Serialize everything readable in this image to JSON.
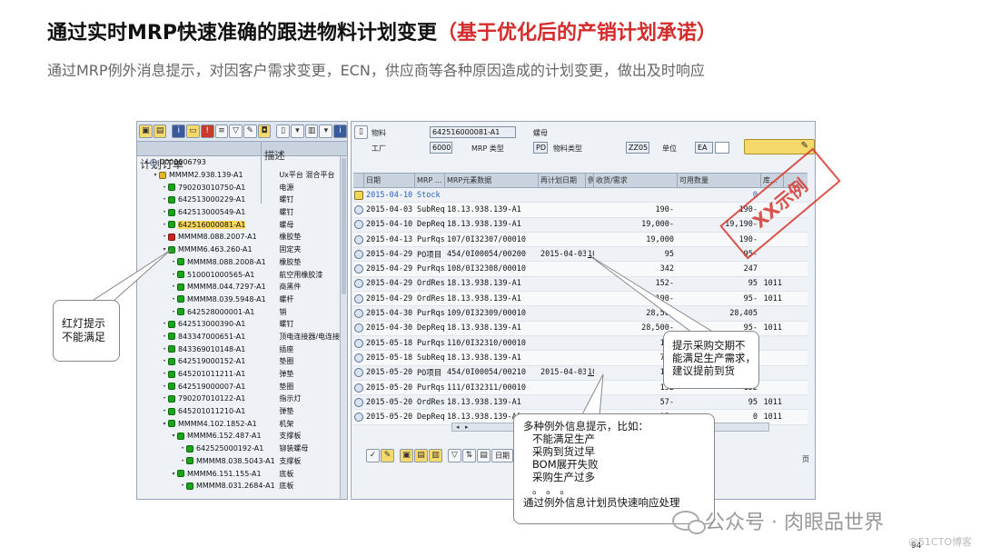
{
  "slide": {
    "title_main": "通过实时MRP快速准确的跟进物料计划变更",
    "title_highlight": "（基于优化后的产销计划承诺）",
    "subtitle": "通过MRP例外消息提示，对因客户需求变更，ECN，供应商等各种原因造成的计划变更，做出及时响应"
  },
  "tree": {
    "col_header_1": "计划订单",
    "col_header_2": "描述",
    "rows": [
      {
        "indent": 0,
        "tw": "▾",
        "lamp": "blue",
        "id": "0000006793",
        "desc": ""
      },
      {
        "indent": 1,
        "tw": "▾",
        "lamp": "yel",
        "id": "MMMM2.938.139-A1",
        "desc": "Ux平台 混合平台"
      },
      {
        "indent": 2,
        "tw": "•",
        "lamp": "green",
        "id": "790203010750-A1",
        "desc": "电源"
      },
      {
        "indent": 2,
        "tw": "•",
        "lamp": "green",
        "id": "642513000229-A1",
        "desc": "螺钉"
      },
      {
        "indent": 2,
        "tw": "•",
        "lamp": "green",
        "id": "642513000549-A1",
        "desc": "螺钉"
      },
      {
        "indent": 2,
        "tw": "•",
        "lamp": "green",
        "id": "642516000081-A1",
        "desc": "螺母",
        "selected": true
      },
      {
        "indent": 2,
        "tw": "•",
        "lamp": "red",
        "id": "MMMM8.088.2007-A1",
        "desc": "橡胶垫"
      },
      {
        "indent": 2,
        "tw": "▾",
        "lamp": "green",
        "id": "MMMM6.463.260-A1",
        "desc": "固定夹"
      },
      {
        "indent": 3,
        "tw": "•",
        "lamp": "green",
        "id": "MMMM8.088.2008-A1",
        "desc": "橡胶垫"
      },
      {
        "indent": 3,
        "tw": "•",
        "lamp": "green",
        "id": "510001000565-A1",
        "desc": "航空用橡胶漆"
      },
      {
        "indent": 3,
        "tw": "•",
        "lamp": "green",
        "id": "MMMM8.044.7297-A1",
        "desc": "商黑件"
      },
      {
        "indent": 3,
        "tw": "•",
        "lamp": "green",
        "id": "MMMM8.039.5948-A1",
        "desc": "螺杆"
      },
      {
        "indent": 3,
        "tw": "•",
        "lamp": "green",
        "id": "642528000001-A1",
        "desc": "销"
      },
      {
        "indent": 2,
        "tw": "•",
        "lamp": "green",
        "id": "642513000390-A1",
        "desc": "螺钉"
      },
      {
        "indent": 2,
        "tw": "•",
        "lamp": "green",
        "id": "843347000651-A1",
        "desc": "顶电连接器/电连接器"
      },
      {
        "indent": 2,
        "tw": "•",
        "lamp": "green",
        "id": "843369010148-A1",
        "desc": "插座"
      },
      {
        "indent": 2,
        "tw": "•",
        "lamp": "green",
        "id": "642519000152-A1",
        "desc": "垫圈"
      },
      {
        "indent": 2,
        "tw": "•",
        "lamp": "green",
        "id": "645201011211-A1",
        "desc": "弹垫"
      },
      {
        "indent": 2,
        "tw": "•",
        "lamp": "green",
        "id": "642519000007-A1",
        "desc": "垫圈"
      },
      {
        "indent": 2,
        "tw": "•",
        "lamp": "green",
        "id": "790207010122-A1",
        "desc": "指示灯"
      },
      {
        "indent": 2,
        "tw": "•",
        "lamp": "green",
        "id": "645201011210-A1",
        "desc": "弹垫"
      },
      {
        "indent": 2,
        "tw": "▾",
        "lamp": "green",
        "id": "MMMM4.102.1852-A1",
        "desc": "机架"
      },
      {
        "indent": 3,
        "tw": "▾",
        "lamp": "green",
        "id": "MMMM6.152.487-A1",
        "desc": "支撑板"
      },
      {
        "indent": 4,
        "tw": "•",
        "lamp": "green",
        "id": "642525000192-A1",
        "desc": "铆装螺母"
      },
      {
        "indent": 4,
        "tw": "•",
        "lamp": "green",
        "id": "MMMM8.038.5043-A1",
        "desc": "支撑板"
      },
      {
        "indent": 3,
        "tw": "▾",
        "lamp": "green",
        "id": "MMMM6.151.155-A1",
        "desc": "底板"
      },
      {
        "indent": 4,
        "tw": "•",
        "lamp": "green",
        "id": "MMMM8.031.2684-A1",
        "desc": "底板"
      }
    ]
  },
  "header": {
    "material_label": "物料",
    "material_value": "642516000081-A1",
    "material_desc": "螺母",
    "plant_label": "工厂",
    "plant_value": "6000",
    "mrp_type_label": "MRP 类型",
    "mrp_type_value": "PD",
    "material_type_label": "物料类型",
    "material_type_value": "ZZ05",
    "unit_label": "单位",
    "unit_value": "EA"
  },
  "grid": {
    "headers": [
      "",
      "日期",
      "MRP ...",
      "MRP元素数据",
      "再计划日期",
      "例.",
      "收货/需求",
      "可用数量",
      "库..."
    ],
    "rows": [
      {
        "icon": "sq",
        "date": "2015-04-10",
        "el": "Stock",
        "data": "",
        "res": "",
        "ex": "",
        "rec": "",
        "avl": "0",
        "st": "",
        "blue": true
      },
      {
        "icon": "c",
        "date": "2015-04-03",
        "el": "SubReq",
        "data": "18.13.938.139-A1",
        "res": "",
        "ex": "",
        "rec": "190-",
        "avl": "190-",
        "st": ""
      },
      {
        "icon": "c",
        "date": "2015-04-10",
        "el": "DepReq",
        "data": "18.13.938.139-A1",
        "res": "",
        "ex": "",
        "rec": "19,000-",
        "avl": "19,190-",
        "st": ""
      },
      {
        "icon": "c",
        "date": "2015-04-13",
        "el": "PurRqs",
        "data": "107/0I32307/00010",
        "res": "",
        "ex": "",
        "rec": "19,000",
        "avl": "190-",
        "st": ""
      },
      {
        "icon": "c",
        "date": "2015-04-29",
        "el": "PO项目",
        "data": "454/0I00054/00200",
        "res": "2015-04-03",
        "ex": "10",
        "rec": "95",
        "avl": "95-",
        "st": ""
      },
      {
        "icon": "c",
        "date": "2015-04-29",
        "el": "PurRqs",
        "data": "108/0I32308/00010",
        "res": "",
        "ex": "",
        "rec": "342",
        "avl": "247",
        "st": ""
      },
      {
        "icon": "c",
        "date": "2015-04-29",
        "el": "OrdRes",
        "data": "18.13.938.139-A1",
        "res": "",
        "ex": "",
        "rec": "152-",
        "avl": "95",
        "st": "1011"
      },
      {
        "icon": "c",
        "date": "2015-04-29",
        "el": "OrdRes",
        "data": "18.13.938.139-A1",
        "res": "",
        "ex": "",
        "rec": "190-",
        "avl": "95-",
        "st": "1011"
      },
      {
        "icon": "c",
        "date": "2015-04-30",
        "el": "PurRqs",
        "data": "109/0I32309/00010",
        "res": "",
        "ex": "",
        "rec": "28,500",
        "avl": "28,405",
        "st": ""
      },
      {
        "icon": "c",
        "date": "2015-04-30",
        "el": "DepReq",
        "data": "18.13.938.139-A1",
        "res": "",
        "ex": "",
        "rec": "28,500-",
        "avl": "95-",
        "st": "1011"
      },
      {
        "icon": "c",
        "date": "2015-05-18",
        "el": "PurRqs",
        "data": "110/0I32310/00010",
        "res": "",
        "ex": "",
        "rec": "171",
        "avl": "76-",
        "st": ""
      },
      {
        "icon": "c",
        "date": "2015-05-18",
        "el": "SubReq",
        "data": "18.13.938.139-A1",
        "res": "",
        "ex": "",
        "rec": "76-",
        "avl": "152-",
        "st": ""
      },
      {
        "icon": "c",
        "date": "2015-05-20",
        "el": "PO项目",
        "data": "454/0I00054/00210",
        "res": "2015-04-03",
        "ex": "10",
        "rec": "152",
        "avl": "0",
        "st": ""
      },
      {
        "icon": "c",
        "date": "2015-05-20",
        "el": "PurRqs",
        "data": "111/0I32311/00010",
        "res": "",
        "ex": "",
        "rec": "152",
        "avl": "152",
        "st": ""
      },
      {
        "icon": "c",
        "date": "2015-05-20",
        "el": "OrdRes",
        "data": "18.13.938.139-A1",
        "res": "",
        "ex": "",
        "rec": "57-",
        "avl": "95",
        "st": "1011"
      },
      {
        "icon": "c",
        "date": "2015-05-20",
        "el": "DepReq",
        "data": "18.13.938.139-A1",
        "res": "",
        "ex": "",
        "rec": "95-",
        "avl": "0",
        "st": "1011"
      }
    ],
    "bottom_button": "日期",
    "page_label": "页"
  },
  "stamp": "XX示例",
  "callouts": {
    "red_light": [
      "红灯提示",
      "不能满足"
    ],
    "advance": [
      "提示采购交期不",
      "能满足生产需求，",
      "建议提前到货"
    ],
    "exceptions": {
      "intro": "多种例外信息提示，比如：",
      "items": [
        "不能满足生产",
        "采购到货过早",
        "BOM展开失败",
        "采购生产过多",
        "。 。 。"
      ],
      "footer": "通过例外信息计划员快速响应处理"
    }
  },
  "footer": {
    "brand": "公众号 · 肉眼品世界",
    "page_num": "94",
    "watermark": "@51CTO博客"
  }
}
